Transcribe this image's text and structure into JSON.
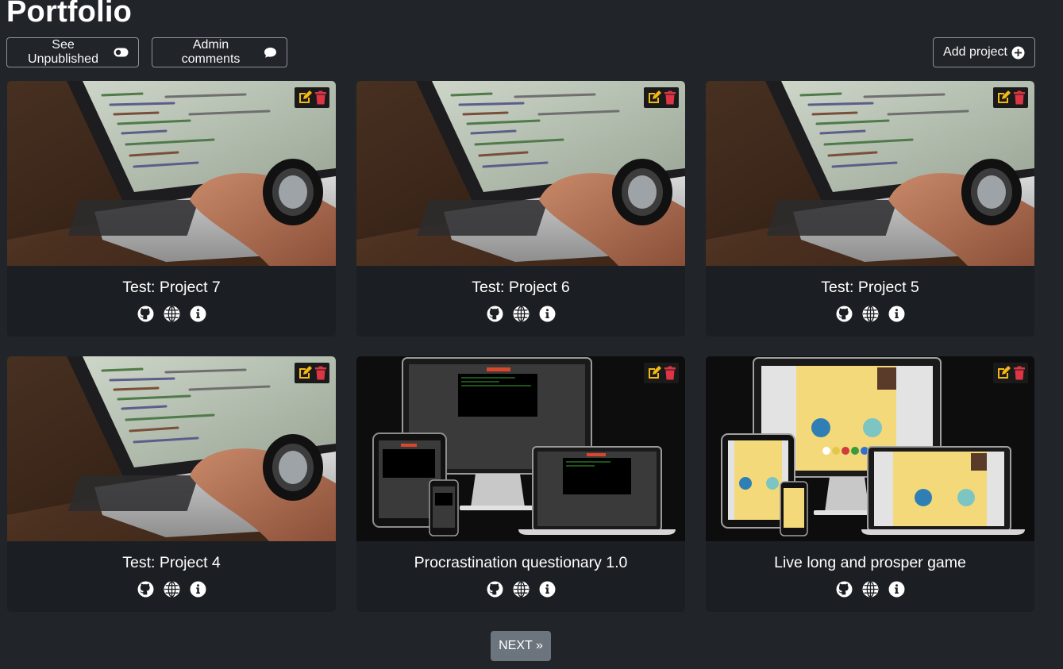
{
  "page": {
    "title": "Portfolio"
  },
  "toolbar": {
    "unpublished_label": "See Unpublished",
    "admin_comments_label": "Admin comments",
    "add_project_label": "Add project"
  },
  "projects": [
    {
      "title": "Test: Project 7",
      "thumbnail": "laptop-code-photo"
    },
    {
      "title": "Test: Project 6",
      "thumbnail": "laptop-code-photo"
    },
    {
      "title": "Test: Project 5",
      "thumbnail": "laptop-code-photo"
    },
    {
      "title": "Test: Project 4",
      "thumbnail": "laptop-code-photo"
    },
    {
      "title": "Procrastination questionary 1.0",
      "thumbnail": "device-mockup-dark"
    },
    {
      "title": "Live long and prosper game",
      "thumbnail": "device-mockup-game"
    }
  ],
  "card_icons": [
    "github-icon",
    "globe-icon",
    "info-icon",
    "edit-icon",
    "trash-icon"
  ],
  "pagination": {
    "next_label": "NEXT »"
  },
  "colors": {
    "background": "#212429",
    "card": "#1b1e22",
    "edit": "#f5b914",
    "delete": "#dc3545",
    "next_button": "#6c757d"
  }
}
